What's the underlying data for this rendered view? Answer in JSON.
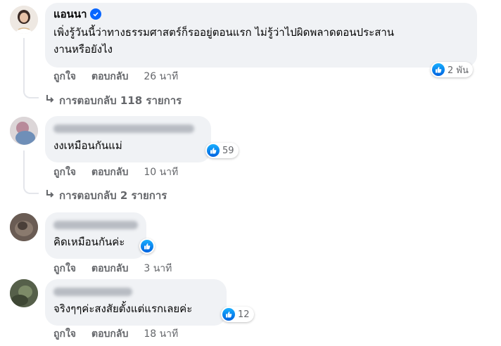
{
  "comments": [
    {
      "author": "แอนนา",
      "verified": true,
      "text_line1": "เพิ่งรู้วันนี้ว่าทางธรรมศาสตร์ก็รออยู่ตอนแรก ไม่รู้ว่าไปผิดพลาดตอนประสาน",
      "text_line2": "งานหรือยังไง",
      "reaction_count": "2 พัน",
      "like_label": "ถูกใจ",
      "reply_label": "ตอบกลับ",
      "time": "26 นาที",
      "replies_label": "การตอบกลับ 118 รายการ"
    },
    {
      "author_blurred": true,
      "text": "งงเหมือนกันแม่",
      "reaction_count": "59",
      "like_label": "ถูกใจ",
      "reply_label": "ตอบกลับ",
      "time": "10 นาที",
      "replies_label": "การตอบกลับ 2 รายการ"
    },
    {
      "author_blurred": true,
      "text": "คิดเหมือนกันค่ะ",
      "reaction_count": "",
      "like_label": "ถูกใจ",
      "reply_label": "ตอบกลับ",
      "time": "3 นาที"
    },
    {
      "author_blurred": true,
      "text": "จริงๆๆค่ะสงสัยตั้งแต่แรกเลยค่ะ",
      "reaction_count": "12",
      "like_label": "ถูกใจ",
      "reply_label": "ตอบกลับ",
      "time": "18 นาที"
    }
  ],
  "icons": {
    "like": "like-thumb-icon",
    "reply_arrow": "reply-arrow-icon",
    "verified": "verified-badge-icon"
  },
  "colors": {
    "bubble": "#f0f2f5",
    "meta": "#65676b",
    "like_blue": "#0866ff"
  }
}
